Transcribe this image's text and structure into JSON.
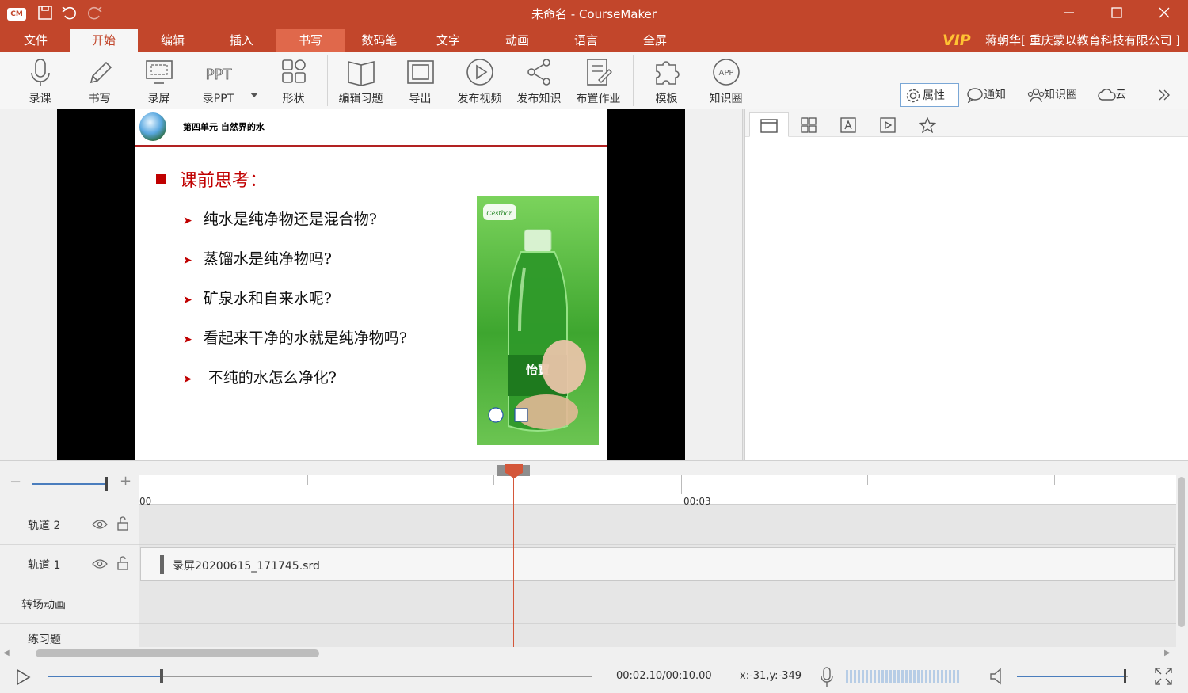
{
  "app": {
    "title": "未命名 - CourseMaker",
    "logo_text": "CM",
    "vip_label": "VIP",
    "user": "蒋朝华[ 重庆蒙以教育科技有限公司 ]"
  },
  "menu": [
    "文件",
    "开始",
    "编辑",
    "插入",
    "书写",
    "数码笔",
    "文字",
    "动画",
    "语言",
    "全屏"
  ],
  "menu_active": "开始",
  "toolbar": [
    {
      "label": "录课",
      "icon": "microphone-icon"
    },
    {
      "label": "书写",
      "icon": "pencil-icon"
    },
    {
      "label": "录屏",
      "icon": "screen-record-icon"
    },
    {
      "label": "录PPT",
      "icon": "ppt-icon"
    },
    {
      "label": "形状",
      "icon": "shapes-icon"
    },
    {
      "label": "编辑习题",
      "icon": "book-icon"
    },
    {
      "label": "导出",
      "icon": "export-icon"
    },
    {
      "label": "发布视频",
      "icon": "play-circle-icon"
    },
    {
      "label": "发布知识",
      "icon": "share-icon"
    },
    {
      "label": "布置作业",
      "icon": "assignment-icon"
    },
    {
      "label": "模板",
      "icon": "puzzle-icon"
    },
    {
      "label": "知识圈",
      "icon": "app-icon"
    }
  ],
  "ppt_icon_text": "PPT",
  "app_icon_text": "APP",
  "right_tabs": [
    {
      "label": "属性",
      "icon": "gear-icon",
      "selected": true
    },
    {
      "label": "通知",
      "icon": "chat-icon"
    },
    {
      "label": "知识圈",
      "icon": "people-icon"
    },
    {
      "label": "云",
      "icon": "cloud-icon"
    }
  ],
  "slide": {
    "header": "第四单元   自然界的水",
    "title": "课前思考：",
    "questions": [
      "纯水是纯净物还是混合物?",
      "蒸馏水是纯净物吗?",
      "矿泉水和自来水呢?",
      "看起来干净的水就是纯净物吗?",
      " 不纯的水怎么净化?"
    ],
    "bottle_brand": "Cestbon",
    "bottle_label": "怡寶"
  },
  "timeline": {
    "ruler_labels": [
      "00",
      "00:03"
    ],
    "tracks": [
      {
        "name": "轨道 2",
        "clip": null
      },
      {
        "name": "轨道 1",
        "clip": "录屏20200615_171745.srd"
      },
      {
        "name": "转场动画",
        "clip": null
      },
      {
        "name": "练习题",
        "clip": null
      }
    ]
  },
  "playback": {
    "timecode": "00:02.10/00:10.00",
    "coords": "x:-31,y:-349",
    "progress": 0.21,
    "volume": 0.98
  },
  "colors": {
    "brand": "#c2462b",
    "accent_red": "#c00000",
    "playhead": "#d4573a"
  }
}
